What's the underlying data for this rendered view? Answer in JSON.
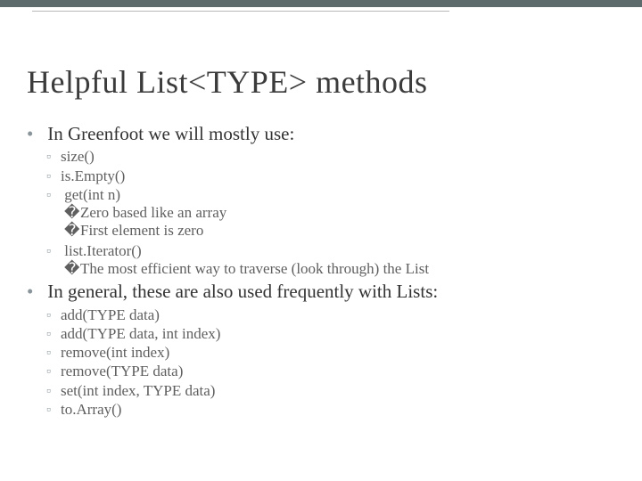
{
  "title": "Helpful List<TYPE> methods",
  "bullets": {
    "a": {
      "text": "In Greenfoot we will mostly use:",
      "items": {
        "i0": "size()",
        "i1": "is.Empty()",
        "i2": "get(int n)",
        "i2sub": {
          "s0": "Zero based like an array",
          "s1": "First element is zero"
        },
        "i3": "list.Iterator()",
        "i3sub": {
          "s0": "The most efficient way to traverse (look through) the List"
        }
      }
    },
    "b": {
      "text": "In general, these are also used frequently with Lists:",
      "items": {
        "i0": "add(TYPE data)",
        "i1": "add(TYPE data, int index)",
        "i2": "remove(int index)",
        "i3": "remove(TYPE data)",
        "i4": "set(int index, TYPE data)",
        "i5": "to.Array()"
      }
    }
  }
}
